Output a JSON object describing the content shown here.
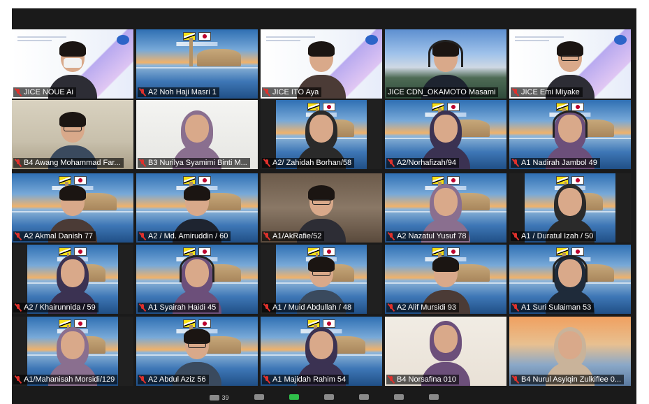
{
  "meeting": {
    "participants_count": "39"
  },
  "participants": [
    {
      "name": "JICE  NOUE Ai",
      "muted": true,
      "bg": "slide",
      "look": "mask"
    },
    {
      "name": "A2 Noh Haji Masri 1",
      "muted": true,
      "bg": "mosque",
      "look": "none"
    },
    {
      "name": "JICE ITO Aya",
      "muted": true,
      "bg": "slide",
      "look": "hair"
    },
    {
      "name": "JICE CDN_OKAMOTO Masami",
      "muted": false,
      "bg": "fuji",
      "look": "headset",
      "active_speaker": true
    },
    {
      "name": "JICE Emi Miyake",
      "muted": true,
      "bg": "slide",
      "look": "glasses"
    },
    {
      "name": "B4 Awang Mohammad Far...",
      "muted": true,
      "bg": "home",
      "look": "glasses"
    },
    {
      "name": "B3 Nurilya Syamimi Binti M...",
      "muted": true,
      "bg": "white",
      "look": "hijab"
    },
    {
      "name": "A2/ Zahidah Borhan/58",
      "muted": true,
      "bg": "mosque",
      "look": "hijab",
      "inset": true
    },
    {
      "name": "A2/Norhafizah/94",
      "muted": true,
      "bg": "mosque",
      "look": "hijab"
    },
    {
      "name": "A1 Nadirah Jambol  49",
      "muted": true,
      "bg": "mosque",
      "look": "headset-hijab"
    },
    {
      "name": "A2 Akmal Danish 77",
      "muted": true,
      "bg": "mosque",
      "look": "plain"
    },
    {
      "name": "A2 / Md. Amiruddin / 60",
      "muted": true,
      "bg": "mosque",
      "look": "plain"
    },
    {
      "name": "A1/AkRafie/52",
      "muted": true,
      "bg": "ornate",
      "look": "glasses"
    },
    {
      "name": "A2 Nazatul Yusuf 78",
      "muted": true,
      "bg": "mosque",
      "look": "hijab"
    },
    {
      "name": "A1 / Duratul Izah / 50",
      "muted": true,
      "bg": "mosque",
      "look": "hijab",
      "inset": true
    },
    {
      "name": "A2 / Khairunnida / 59",
      "muted": true,
      "bg": "mosque",
      "look": "hijab",
      "inset": true
    },
    {
      "name": "A1 Syairah Haidi 45",
      "muted": true,
      "bg": "mosque",
      "look": "headset-hijab"
    },
    {
      "name": "A1 / Muid Abdullah / 48",
      "muted": true,
      "bg": "mosque",
      "look": "glasses",
      "inset": true
    },
    {
      "name": "A2 Alif Mursidi 93",
      "muted": true,
      "bg": "mosque",
      "look": "plain"
    },
    {
      "name": "A1 Suri Sulaiman 53",
      "muted": true,
      "bg": "mosque",
      "look": "headset-hijab"
    },
    {
      "name": "A1/Mahanisah Morsidi/129",
      "muted": true,
      "bg": "mosque",
      "look": "hijab",
      "inset": true
    },
    {
      "name": "A2 Abdul Aziz 56",
      "muted": true,
      "bg": "mosque",
      "look": "glasses"
    },
    {
      "name": "A1 Majidah Rahim 54",
      "muted": true,
      "bg": "mosque",
      "look": "hijab"
    },
    {
      "name": "B4 Norsafina 010",
      "muted": true,
      "bg": "cream",
      "look": "hijab-large"
    },
    {
      "name": "B4 Nurul Asyiqin Zulkiflee 0...",
      "muted": true,
      "bg": "bridge",
      "look": "hijab"
    }
  ],
  "colors": {
    "active_speaker_border": "#b8d94a",
    "muted_icon": "#e0312c",
    "label_bg": "rgba(0,0,0,0.62)",
    "skin": "#d9a98a",
    "hijab_colors": [
      "#2a2a2a",
      "#3b3252",
      "#6c4f7a",
      "#c9b39a",
      "#e8dccb",
      "#1f2b3a",
      "#8a6f8f"
    ]
  },
  "toolbar": {
    "participants_icon": "participants-icon",
    "share_icon": "share-screen-icon"
  }
}
